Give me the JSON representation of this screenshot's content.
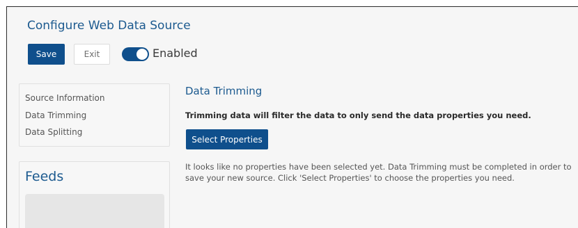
{
  "header": {
    "title": "Configure Web Data Source",
    "save_label": "Save",
    "exit_label": "Exit",
    "toggle_label": "Enabled",
    "toggle_on": true
  },
  "sidebar": {
    "items": [
      {
        "label": "Source Information"
      },
      {
        "label": "Data Trimming"
      },
      {
        "label": "Data Splitting"
      }
    ],
    "feeds_title": "Feeds"
  },
  "main": {
    "section_title": "Data Trimming",
    "description": "Trimming data will filter the data to only send the data properties you need.",
    "select_button_label": "Select Properties",
    "info_text": "It looks like no properties have been selected yet. Data Trimming must be completed in order to save your new source. Click 'Select Properties' to choose the properties you need."
  },
  "colors": {
    "primary": "#0f4f8c",
    "title": "#1c5a8f",
    "background": "#f6f6f6"
  }
}
